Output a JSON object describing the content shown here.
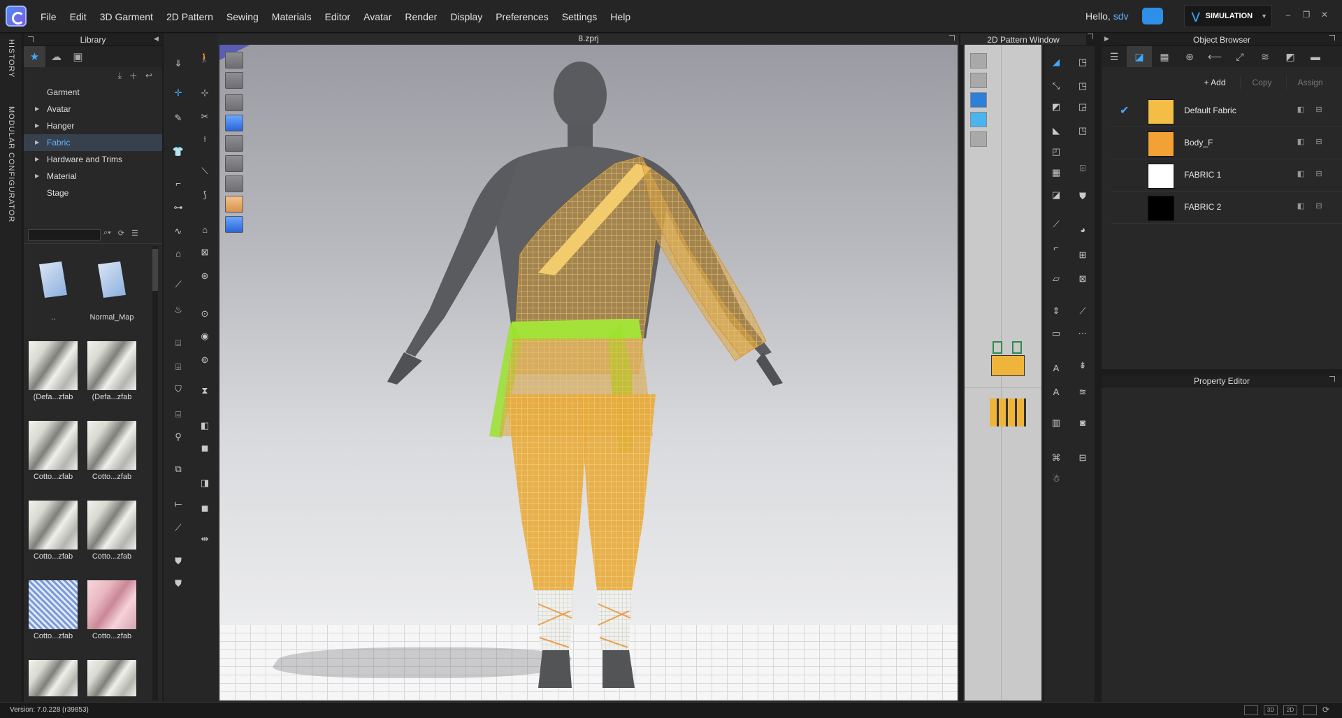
{
  "menubar": {
    "items": [
      "File",
      "Edit",
      "3D Garment",
      "2D Pattern",
      "Sewing",
      "Materials",
      "Editor",
      "Avatar",
      "Render",
      "Display",
      "Preferences",
      "Settings",
      "Help"
    ],
    "greeting": "Hello,",
    "username": "sdv",
    "mode_button": "SIMULATION"
  },
  "side_strip": {
    "history": "HISTORY",
    "modular": "MODULAR CONFIGURATOR"
  },
  "library": {
    "title": "Library",
    "tree": [
      {
        "label": "Garment",
        "arrow": ""
      },
      {
        "label": "Avatar",
        "arrow": "▶"
      },
      {
        "label": "Hanger",
        "arrow": "▶"
      },
      {
        "label": "Fabric",
        "arrow": "▶"
      },
      {
        "label": "Hardware and Trims",
        "arrow": "▶"
      },
      {
        "label": "Material",
        "arrow": "▶"
      },
      {
        "label": "Stage",
        "arrow": ""
      }
    ],
    "selected": "Fabric",
    "thumbnails": [
      {
        "label": "..",
        "kind": "folder"
      },
      {
        "label": "Normal_Map",
        "kind": "folder"
      },
      {
        "label": "(Defa...zfab",
        "kind": "fabric"
      },
      {
        "label": "(Defa...zfab",
        "kind": "fabric"
      },
      {
        "label": "Cotto...zfab",
        "kind": "fabric"
      },
      {
        "label": "Cotto...zfab",
        "kind": "fabric"
      },
      {
        "label": "Cotto...zfab",
        "kind": "fabric"
      },
      {
        "label": "Cotto...zfab",
        "kind": "fabric"
      },
      {
        "label": "Cotto...zfab",
        "kind": "fabric"
      },
      {
        "label": "Cotto...zfab",
        "kind": "fabric"
      }
    ]
  },
  "viewport": {
    "title": "8.zprj"
  },
  "pattern_window": {
    "title": "2D Pattern Window"
  },
  "object_browser": {
    "title": "Object Browser",
    "add": "+ Add",
    "copy": "Copy",
    "assign": "Assign",
    "fabrics": [
      {
        "name": "Default Fabric",
        "color": "#f4bd45",
        "checked": true
      },
      {
        "name": "Body_F",
        "color": "#f2a234",
        "checked": false
      },
      {
        "name": "FABRIC 1",
        "color": "#ffffff",
        "checked": false
      },
      {
        "name": "FABRIC 2",
        "color": "#000000",
        "checked": false
      }
    ]
  },
  "property_editor": {
    "title": "Property Editor"
  },
  "status": {
    "version": "Version: 7.0.228 (r39853)",
    "view_3d": "3D",
    "view_2d": "2D"
  }
}
